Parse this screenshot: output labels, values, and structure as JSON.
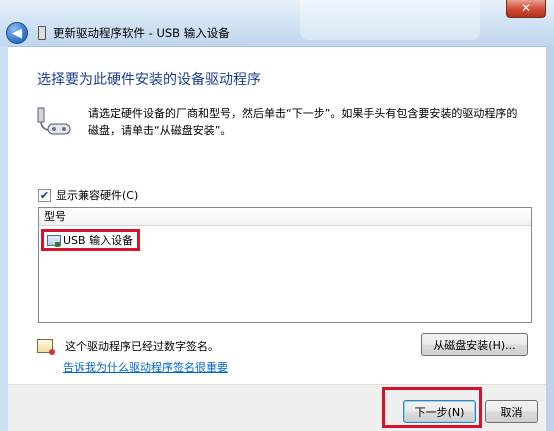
{
  "window": {
    "title": "更新驱动程序软件 - USB 输入设备",
    "close_label": "✕",
    "back_label": "◀"
  },
  "main": {
    "heading": "选择要为此硬件安装的设备驱动程序",
    "description": "请选定硬件设备的厂商和型号，然后单击“下一步”。如果手头有包含要安装的驱动程序的磁盘，请单击“从磁盘安装”。",
    "show_compatible": {
      "label": "显示兼容硬件(C)",
      "checked": true,
      "check_glyph": "✔"
    },
    "model_list": {
      "header": "型号",
      "items": [
        {
          "label": "USB 输入设备",
          "selected": true
        }
      ]
    },
    "signature_text": "这个驱动程序已经过数字签名。",
    "signature_link": "告诉我为什么驱动程序签名很重要",
    "have_disk_label": "从磁盘安装(H)..."
  },
  "footer": {
    "next_label": "下一步(N)",
    "cancel_label": "取消"
  },
  "colors": {
    "heading": "#1e3f8f",
    "link": "#0066cc",
    "highlight_box": "#d8122a"
  }
}
